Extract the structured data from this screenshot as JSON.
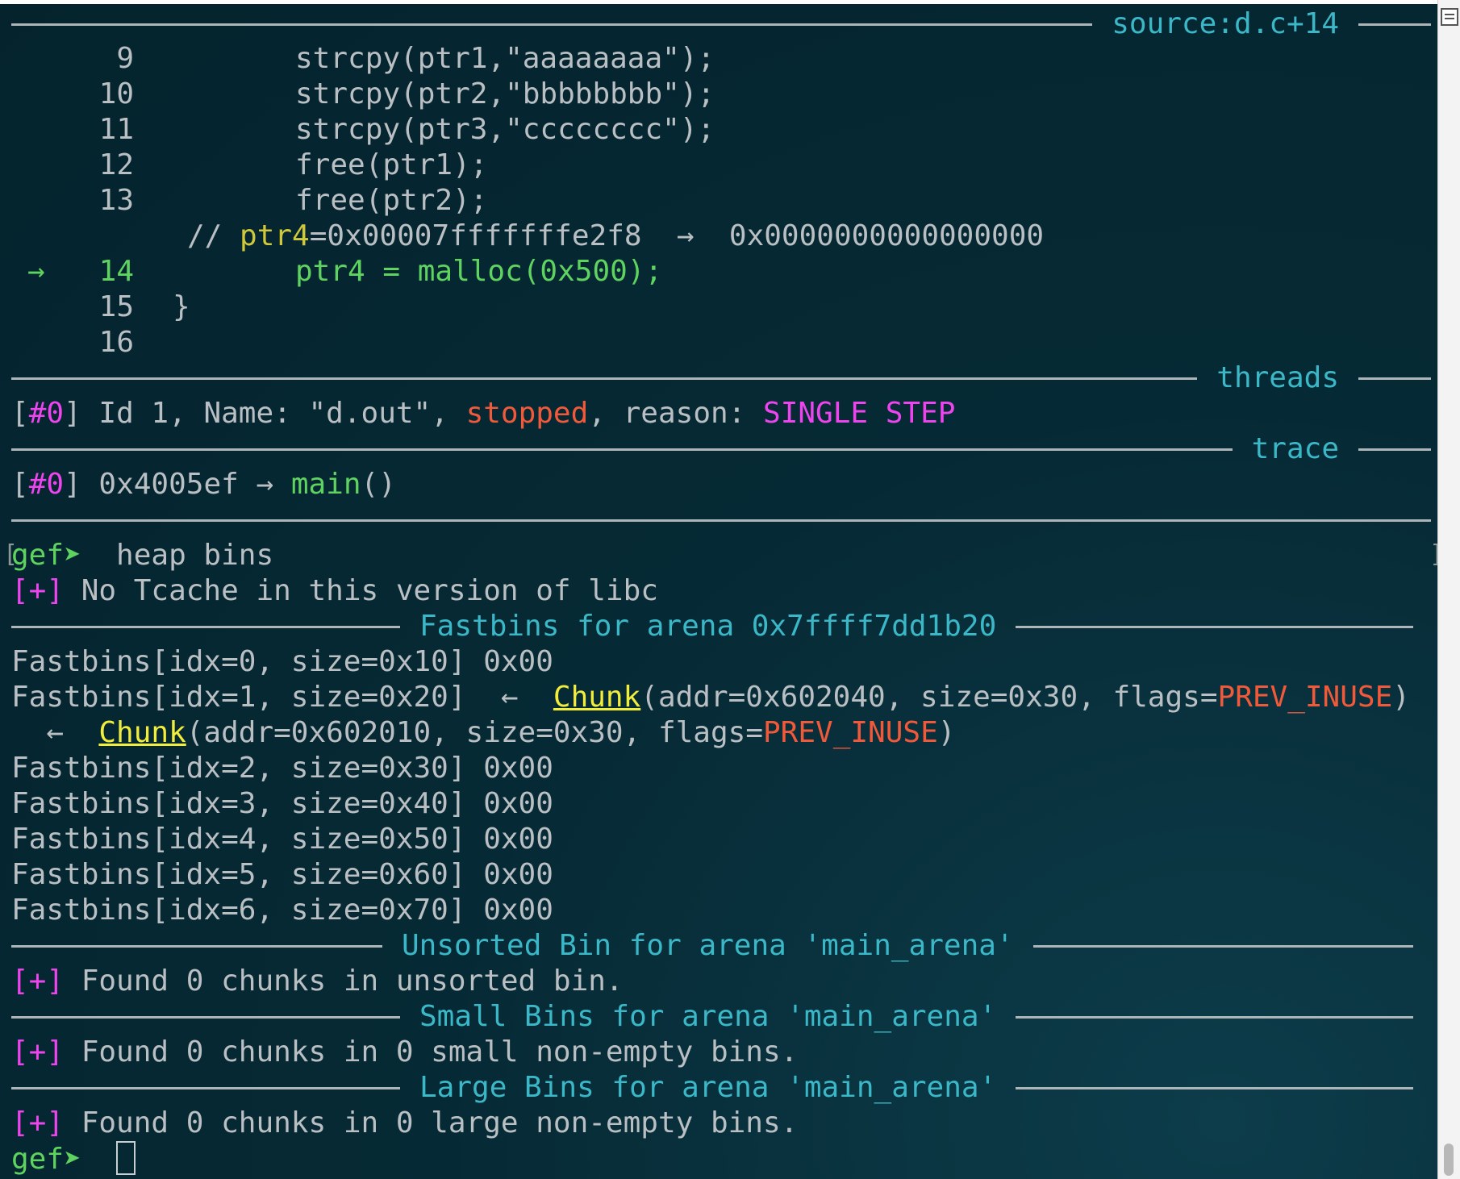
{
  "source_panel": {
    "title": "source:d.c+14",
    "lines": [
      {
        "num": "9",
        "code": "strcpy(ptr1,\"aaaaaaaa\");"
      },
      {
        "num": "10",
        "code": "strcpy(ptr2,\"bbbbbbbb\");"
      },
      {
        "num": "11",
        "code": "strcpy(ptr3,\"cccccccc\");"
      },
      {
        "num": "12",
        "code": "free(ptr1);"
      },
      {
        "num": "13",
        "code": "free(ptr2);"
      }
    ],
    "comment_prefix": "// ",
    "comment_var": "ptr4",
    "comment_rest": "=0x00007fffffffe2f8  →  0x0000000000000000",
    "current_marker": "→",
    "current_num": "14",
    "current_code": "ptr4 = malloc(0x500);",
    "after_lines": [
      {
        "num": "15",
        "code": "}"
      },
      {
        "num": "16",
        "code": ""
      }
    ]
  },
  "threads_panel": {
    "title": "threads",
    "open_bracket": "[",
    "thread_id": "#0",
    "close_bracket": "]",
    "info": " Id 1, Name: \"d.out\", ",
    "state": "stopped",
    "reason_label": ", reason: ",
    "reason": "SINGLE STEP"
  },
  "trace_panel": {
    "title": "trace",
    "open_bracket": "[",
    "frame_id": "#0",
    "close_bracket": "]",
    "address": " 0x4005ef → ",
    "function": "main",
    "parens": "()"
  },
  "console": {
    "prompt": "gef➤",
    "command": "  heap bins",
    "info_mark": "[+]",
    "tcache_msg": " No Tcache in this version of libc",
    "fastbins_title": "Fastbins for arena 0x7ffff7dd1b20",
    "fastbin_rows": [
      "Fastbins[idx=0, size=0x10] 0x00",
      "Fastbins[idx=1, size=0x20]  ←  "
    ],
    "chunk_word": "Chunk",
    "chunk1_rest": "(addr=0x602040, size=0x30, flags=",
    "chunk2_prefix": "  ←  ",
    "chunk2_rest": "(addr=0x602010, size=0x30, flags=",
    "flag_value": "PREV_INUSE",
    "close_paren": ")",
    "empty_fastbins": [
      "Fastbins[idx=2, size=0x30] 0x00",
      "Fastbins[idx=3, size=0x40] 0x00",
      "Fastbins[idx=4, size=0x50] 0x00",
      "Fastbins[idx=5, size=0x60] 0x00",
      "Fastbins[idx=6, size=0x70] 0x00"
    ],
    "unsorted_title": "Unsorted Bin for arena 'main_arena'",
    "unsorted_msg": " Found 0 chunks in unsorted bin.",
    "small_title": "Small Bins for arena 'main_arena'",
    "small_msg": " Found 0 chunks in 0 small non-empty bins.",
    "large_title": "Large Bins for arena 'main_arena'",
    "large_msg": " Found 0 chunks in 0 large non-empty bins.",
    "final_prompt": "gef➤"
  },
  "colors": {
    "background": "#062a35",
    "section_title": "#3bb8c8",
    "prompt": "#5fd35f",
    "highlight": "#cfc83a",
    "stopped": "#f05a3a",
    "reason": "#ee44ee"
  }
}
